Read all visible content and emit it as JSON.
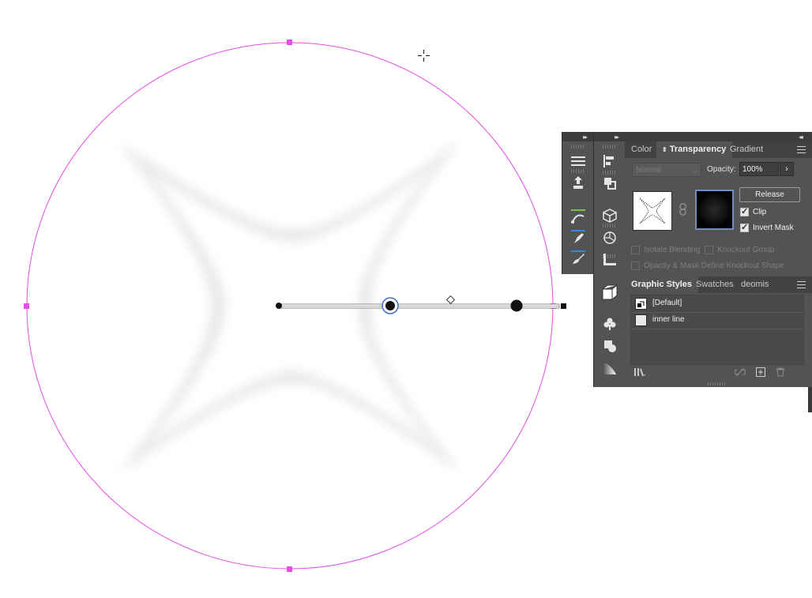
{
  "transparency_panel": {
    "tabs": [
      "Color",
      "Transparency",
      "Gradient"
    ],
    "active_tab": "Transparency",
    "blend_mode": "Normal",
    "opacity_label": "Opacity:",
    "opacity_value": "100%",
    "release_button": "Release",
    "clip_label": "Clip",
    "clip_checked": true,
    "invert_mask_label": "Invert Mask",
    "invert_mask_checked": true,
    "isolate_blending_label": "Isolate Blending",
    "knockout_group_label": "Knockout Group",
    "opacity_mask_knockout_label": "Opacity & Mask Define Knockout Shape"
  },
  "graphic_styles_panel": {
    "tabs": [
      "Graphic Styles",
      "Swatches",
      "deomis"
    ],
    "active_tab": "Graphic Styles",
    "styles": [
      {
        "label": "[Default]"
      },
      {
        "label": "inner line"
      }
    ]
  },
  "icons": {
    "strip_a": [
      "layers-icon",
      "asset-export-icon",
      "curvature-icon",
      "pen-icon",
      "brush-icon"
    ],
    "strip_b": [
      "align-icon",
      "pathfinder-icon",
      "3d-extrude-icon",
      "3d-revolve-icon",
      "ruler-icon",
      "3d-box-icon",
      "symbols-club-icon",
      "shape-builder-icon",
      "gradient-icon"
    ]
  },
  "colors": {
    "selection_magenta": "#e64ce6",
    "panel_bg": "#535353",
    "tab_bar_bg": "#424242",
    "mask_highlight": "#6f8ec8"
  }
}
